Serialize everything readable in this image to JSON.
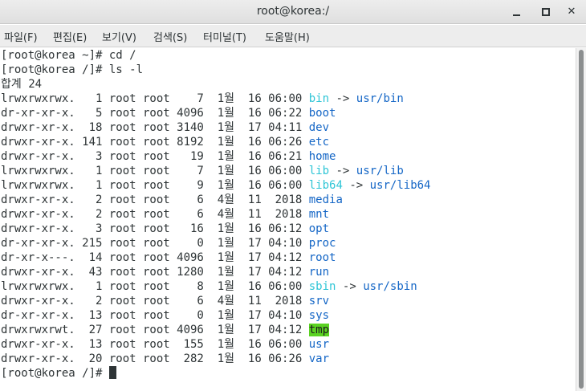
{
  "window": {
    "title": "root@korea:/"
  },
  "menu": [
    {
      "label": "파일(F)"
    },
    {
      "label": "편집(E)"
    },
    {
      "label": "보기(V)"
    },
    {
      "label": "검색(S)"
    },
    {
      "label": "터미널(T)"
    },
    {
      "label": "도움말(H)"
    }
  ],
  "terminal": {
    "prompt_cd": "[root@korea ~]# cd /",
    "prompt_ls": "[root@korea /]# ls -l",
    "total": "합계 24",
    "entries": [
      {
        "meta": "lrwxrwxrwx.   1 root root    7  1월  16 06:00 ",
        "name": "bin",
        "arrow": " -> ",
        "target": "usr/bin",
        "type": "link"
      },
      {
        "meta": "dr-xr-xr-x.   5 root root 4096  1월  16 06:22 ",
        "name": "boot",
        "type": "dir"
      },
      {
        "meta": "drwxr-xr-x.  18 root root 3140  1월  17 04:11 ",
        "name": "dev",
        "type": "dir"
      },
      {
        "meta": "drwxr-xr-x. 141 root root 8192  1월  16 06:26 ",
        "name": "etc",
        "type": "dir"
      },
      {
        "meta": "drwxr-xr-x.   3 root root   19  1월  16 06:21 ",
        "name": "home",
        "type": "dir"
      },
      {
        "meta": "lrwxrwxrwx.   1 root root    7  1월  16 06:00 ",
        "name": "lib",
        "arrow": " -> ",
        "target": "usr/lib",
        "type": "link"
      },
      {
        "meta": "lrwxrwxrwx.   1 root root    9  1월  16 06:00 ",
        "name": "lib64",
        "arrow": " -> ",
        "target": "usr/lib64",
        "type": "link"
      },
      {
        "meta": "drwxr-xr-x.   2 root root    6  4월  11  2018 ",
        "name": "media",
        "type": "dir"
      },
      {
        "meta": "drwxr-xr-x.   2 root root    6  4월  11  2018 ",
        "name": "mnt",
        "type": "dir"
      },
      {
        "meta": "drwxr-xr-x.   3 root root   16  1월  16 06:12 ",
        "name": "opt",
        "type": "dir"
      },
      {
        "meta": "dr-xr-xr-x. 215 root root    0  1월  17 04:10 ",
        "name": "proc",
        "type": "dir"
      },
      {
        "meta": "dr-xr-x---.  14 root root 4096  1월  17 04:12 ",
        "name": "root",
        "type": "dir"
      },
      {
        "meta": "drwxr-xr-x.  43 root root 1280  1월  17 04:12 ",
        "name": "run",
        "type": "dir"
      },
      {
        "meta": "lrwxrwxrwx.   1 root root    8  1월  16 06:00 ",
        "name": "sbin",
        "arrow": " -> ",
        "target": "usr/sbin",
        "type": "link"
      },
      {
        "meta": "drwxr-xr-x.   2 root root    6  4월  11  2018 ",
        "name": "srv",
        "type": "dir"
      },
      {
        "meta": "dr-xr-xr-x.  13 root root    0  1월  17 04:10 ",
        "name": "sys",
        "type": "dir"
      },
      {
        "meta": "drwxrwxrwt.  27 root root 4096  1월  17 04:12 ",
        "name": "tmp",
        "type": "sticky"
      },
      {
        "meta": "drwxr-xr-x.  13 root root  155  1월  16 06:00 ",
        "name": "usr",
        "type": "dir"
      },
      {
        "meta": "drwxr-xr-x.  20 root root  282  1월  16 06:26 ",
        "name": "var",
        "type": "dir"
      }
    ],
    "prompt_final": "[root@korea /]# "
  },
  "colors": {
    "dir": "#1466c6",
    "link": "#2ec5d6",
    "sticky_bg": "#5ad221"
  }
}
